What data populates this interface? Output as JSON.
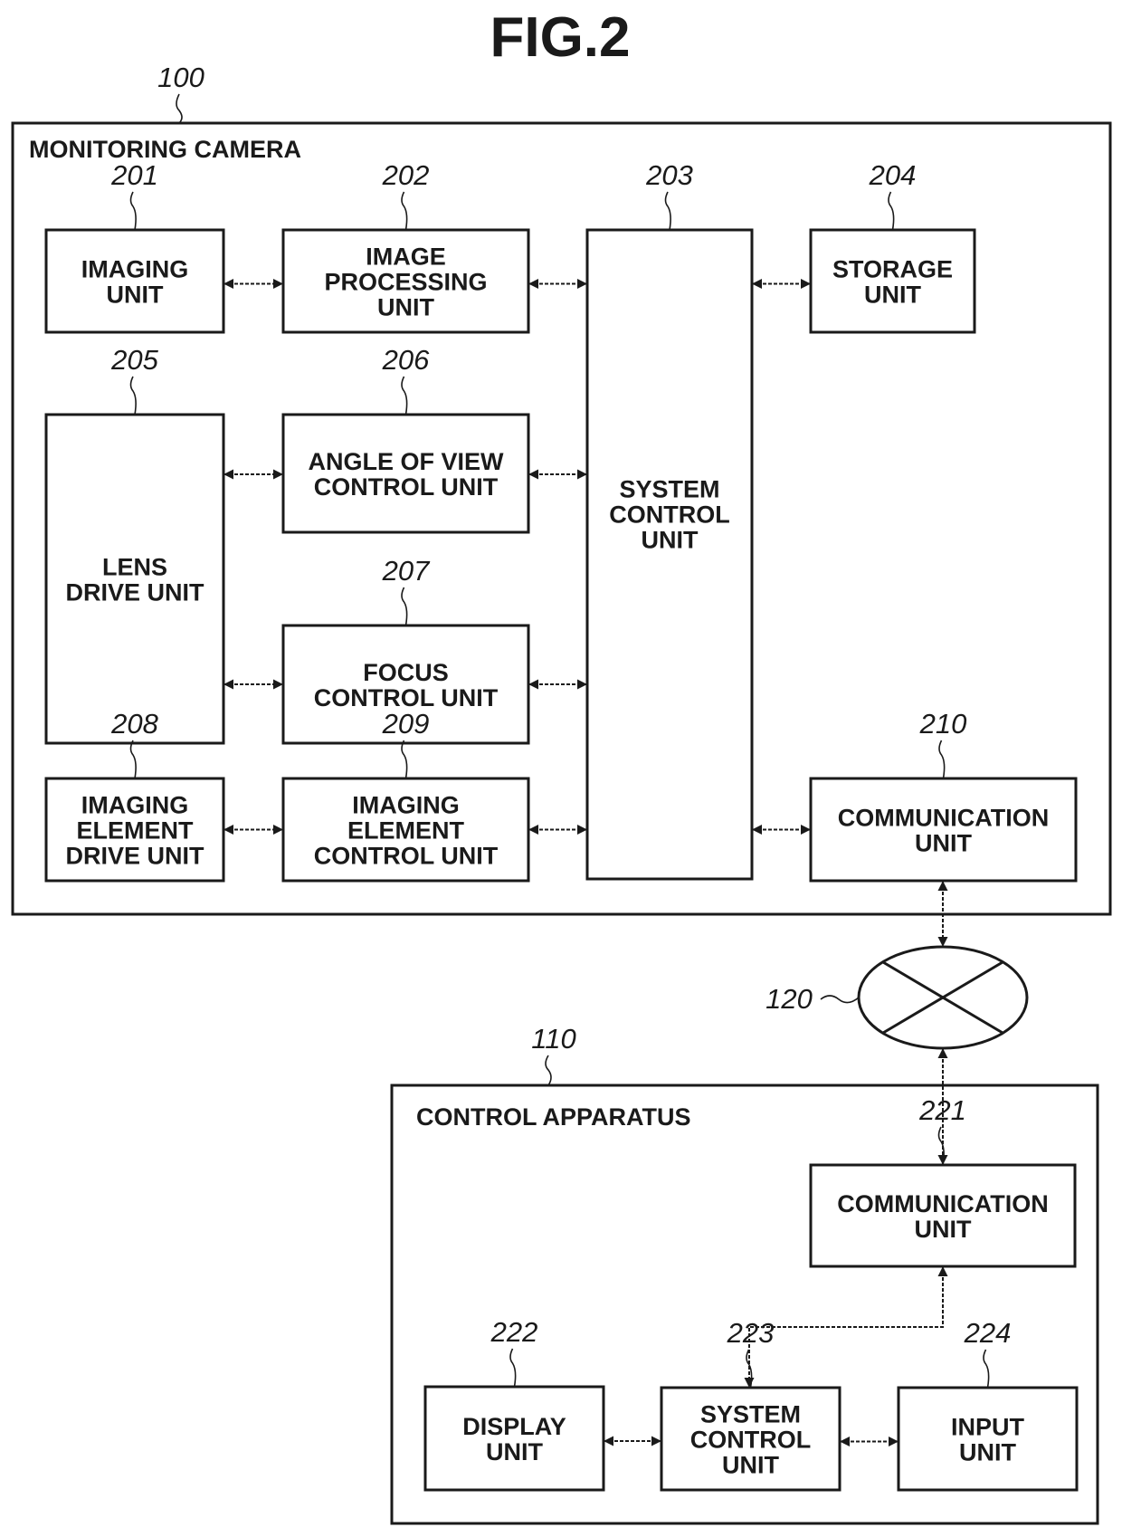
{
  "figure": {
    "title": "FIG.2"
  },
  "monitoring_camera": {
    "ref": "100",
    "label": "MONITORING CAMERA",
    "blocks": [
      {
        "id": "imaging_unit",
        "ref": "201",
        "lines": [
          "IMAGING",
          "UNIT"
        ]
      },
      {
        "id": "image_processing_unit",
        "ref": "202",
        "lines": [
          "IMAGE",
          "PROCESSING",
          "UNIT"
        ]
      },
      {
        "id": "system_control_unit",
        "ref": "203",
        "lines": [
          "SYSTEM",
          "CONTROL",
          "UNIT"
        ]
      },
      {
        "id": "storage_unit",
        "ref": "204",
        "lines": [
          "STORAGE",
          "UNIT"
        ]
      },
      {
        "id": "lens_drive_unit",
        "ref": "205",
        "lines": [
          "LENS",
          "DRIVE UNIT"
        ]
      },
      {
        "id": "angle_of_view_control_unit",
        "ref": "206",
        "lines": [
          "ANGLE OF VIEW",
          "CONTROL UNIT"
        ]
      },
      {
        "id": "focus_control_unit",
        "ref": "207",
        "lines": [
          "FOCUS",
          "CONTROL UNIT"
        ]
      },
      {
        "id": "imaging_element_drive_unit",
        "ref": "208",
        "lines": [
          "IMAGING",
          "ELEMENT",
          "DRIVE UNIT"
        ]
      },
      {
        "id": "imaging_element_control_unit",
        "ref": "209",
        "lines": [
          "IMAGING",
          "ELEMENT",
          "CONTROL UNIT"
        ]
      },
      {
        "id": "communication_unit",
        "ref": "210",
        "lines": [
          "COMMUNICATION",
          "UNIT"
        ]
      }
    ]
  },
  "network": {
    "ref": "120"
  },
  "control_apparatus": {
    "ref": "110",
    "label": "CONTROL APPARATUS",
    "blocks": [
      {
        "id": "communication_unit",
        "ref": "221",
        "lines": [
          "COMMUNICATION",
          "UNIT"
        ]
      },
      {
        "id": "display_unit",
        "ref": "222",
        "lines": [
          "DISPLAY",
          "UNIT"
        ]
      },
      {
        "id": "system_control_unit",
        "ref": "223",
        "lines": [
          "SYSTEM",
          "CONTROL",
          "UNIT"
        ]
      },
      {
        "id": "input_unit",
        "ref": "224",
        "lines": [
          "INPUT",
          "UNIT"
        ]
      }
    ]
  },
  "connections": [
    {
      "from": "201",
      "to": "202",
      "type": "bidirectional"
    },
    {
      "from": "202",
      "to": "203",
      "type": "bidirectional"
    },
    {
      "from": "203",
      "to": "204",
      "type": "bidirectional"
    },
    {
      "from": "205",
      "to": "206",
      "type": "bidirectional"
    },
    {
      "from": "206",
      "to": "203",
      "type": "bidirectional"
    },
    {
      "from": "205",
      "to": "207",
      "type": "bidirectional"
    },
    {
      "from": "207",
      "to": "203",
      "type": "bidirectional"
    },
    {
      "from": "208",
      "to": "209",
      "type": "bidirectional"
    },
    {
      "from": "209",
      "to": "203",
      "type": "bidirectional"
    },
    {
      "from": "203",
      "to": "210",
      "type": "bidirectional"
    },
    {
      "from": "210",
      "to": "120",
      "type": "bidirectional"
    },
    {
      "from": "120",
      "to": "221",
      "type": "bidirectional"
    },
    {
      "from": "221",
      "to": "223",
      "type": "bidirectional"
    },
    {
      "from": "222",
      "to": "223",
      "type": "bidirectional"
    },
    {
      "from": "223",
      "to": "224",
      "type": "bidirectional"
    }
  ]
}
